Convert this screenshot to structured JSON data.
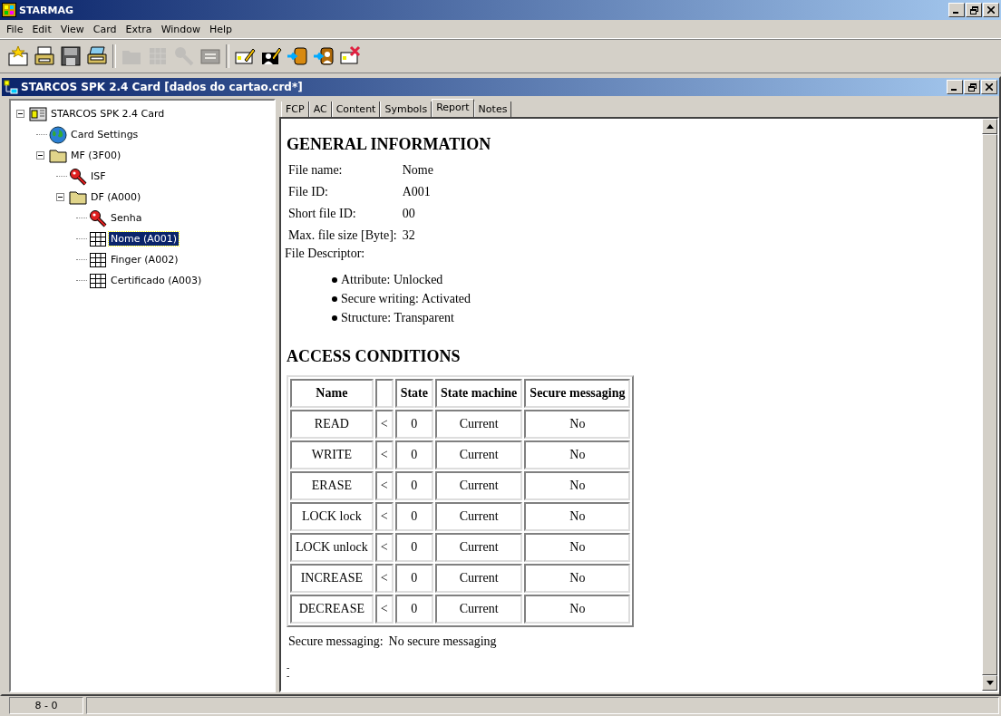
{
  "window": {
    "title": "STARMAG"
  },
  "menu": [
    "File",
    "Edit",
    "View",
    "Card",
    "Extra",
    "Window",
    "Help"
  ],
  "toolbar": [
    {
      "kind": "new-card",
      "disabled": false
    },
    {
      "kind": "open",
      "disabled": false
    },
    {
      "kind": "save",
      "disabled": false
    },
    {
      "kind": "print",
      "disabled": false
    },
    {
      "kind": "folder",
      "disabled": true
    },
    {
      "kind": "table",
      "disabled": true
    },
    {
      "kind": "key",
      "disabled": true
    },
    {
      "kind": "document",
      "disabled": true
    },
    {
      "kind": "edit-card",
      "disabled": false
    },
    {
      "kind": "edit-person",
      "disabled": false
    },
    {
      "kind": "import-db",
      "disabled": false
    },
    {
      "kind": "import-person",
      "disabled": false
    },
    {
      "kind": "delete-card",
      "disabled": false
    }
  ],
  "child_window": {
    "title": "STARCOS SPK 2.4 Card [dados do cartao.crd*]"
  },
  "tree": [
    {
      "label": "STARCOS SPK 2.4 Card",
      "kind": "card",
      "expanded": true,
      "selected": false,
      "children": [
        {
          "label": "Card Settings",
          "kind": "globe",
          "selected": false
        },
        {
          "label": "MF (3F00)",
          "kind": "folder",
          "expanded": true,
          "selected": false,
          "children": [
            {
              "label": "ISF",
              "kind": "key",
              "selected": false
            },
            {
              "label": "DF (A000)",
              "kind": "folder",
              "expanded": true,
              "selected": false,
              "children": [
                {
                  "label": "Senha",
                  "kind": "key",
                  "selected": false
                },
                {
                  "label": "Nome (A001)",
                  "kind": "table",
                  "selected": true
                },
                {
                  "label": "Finger (A002)",
                  "kind": "table",
                  "selected": false
                },
                {
                  "label": "Certificado (A003)",
                  "kind": "table",
                  "selected": false
                }
              ]
            }
          ]
        }
      ]
    }
  ],
  "tabs": [
    {
      "label": "FCP",
      "selected": false
    },
    {
      "label": "AC",
      "selected": false
    },
    {
      "label": "Content",
      "selected": false
    },
    {
      "label": "Symbols",
      "selected": false
    },
    {
      "label": "Report",
      "selected": true
    },
    {
      "label": "Notes",
      "selected": false
    }
  ],
  "report": {
    "general_heading": "GENERAL INFORMATION",
    "fields": [
      {
        "label": "File name:",
        "value": "Nome"
      },
      {
        "label": "File ID:",
        "value": "A001"
      },
      {
        "label": "Short file ID:",
        "value": "00"
      },
      {
        "label": "Max. file size [Byte]:",
        "value": "32"
      }
    ],
    "descriptor_label": "File Descriptor:",
    "descriptor_items": [
      "Attribute: Unlocked",
      "Secure writing: Activated",
      "Structure: Transparent"
    ],
    "access_heading": "ACCESS CONDITIONS",
    "table": {
      "columns": [
        "Name",
        "",
        "State",
        "State machine",
        "Secure messaging"
      ],
      "rows": [
        [
          "READ",
          "<",
          "0",
          "Current",
          "No"
        ],
        [
          "WRITE",
          "<",
          "0",
          "Current",
          "No"
        ],
        [
          "ERASE",
          "<",
          "0",
          "Current",
          "No"
        ],
        [
          "LOCK lock",
          "<",
          "0",
          "Current",
          "No"
        ],
        [
          "LOCK unlock",
          "<",
          "0",
          "Current",
          "No"
        ],
        [
          "INCREASE",
          "<",
          "0",
          "Current",
          "No"
        ],
        [
          "DECREASE",
          "<",
          "0",
          "Current",
          "No"
        ]
      ]
    },
    "secure_messaging": {
      "label": "Secure messaging:",
      "value": "No secure messaging"
    },
    "trailing_marks": [
      "-",
      "-"
    ]
  },
  "status_bar": {
    "panel_1": "8 - 0"
  }
}
